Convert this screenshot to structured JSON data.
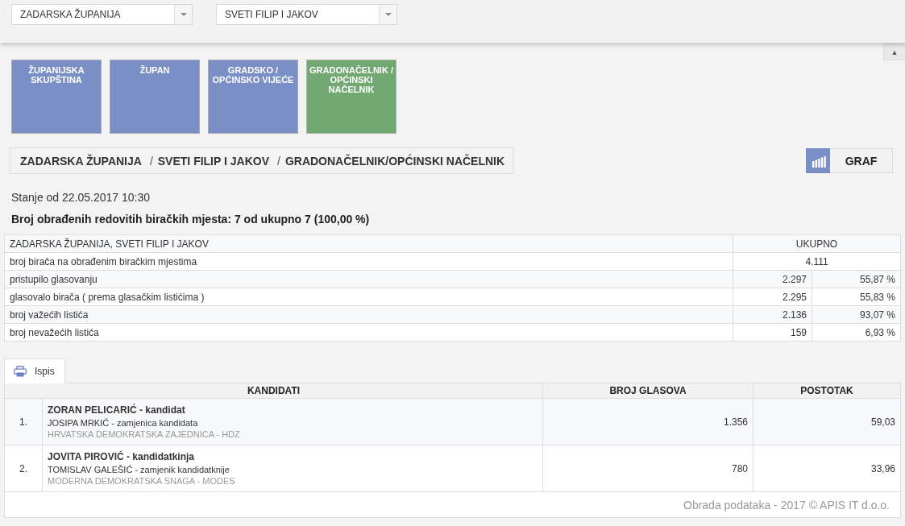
{
  "filters": [
    {
      "value": "ZADARSKA ŽUPANIJA"
    },
    {
      "value": "SVETI FILIP I JAKOV"
    }
  ],
  "collapse_button": {
    "label": "▲"
  },
  "election_tiles": [
    {
      "label": "ŽUPANIJSKA SKUPŠTINA",
      "selected": false
    },
    {
      "label": "ŽUPAN",
      "selected": false
    },
    {
      "label": "GRADSKO / OPĆINSKO VIJEĆE",
      "selected": false
    },
    {
      "label": "GRADONAČELNIK / OPĆINSKI NAČELNIK",
      "selected": true
    }
  ],
  "breadcrumb": [
    {
      "label": "ZADARSKA ŽUPANIJA"
    },
    {
      "separator": "/",
      "label": "SVETI FILIP I JAKOV"
    },
    {
      "separator": "/",
      "label": "GRADONAČELNIK/OPĆINSKI NAČELNIK"
    }
  ],
  "graf_button": {
    "label": "GRAF"
  },
  "status_time": "Stanje od 22.05.2017 10:30",
  "processed_summary": "Broj obrađenih redovitih biračkih mjesta: 7 od ukupno 7 (100,00 %)",
  "summary_table": {
    "columns": [
      "ZADARSKA ŽUPANIJA, SVETI FILIP I JAKOV",
      "UKUPNO"
    ],
    "rows": [
      {
        "label": "broj birača na obrađenim biračkim mjestima",
        "value": "4.111"
      },
      {
        "label": "pristupilo glasovanju",
        "value": "2.297",
        "percent": "55,87 %"
      },
      {
        "label": "glasovalo birača ( prema glasačkim listićima )",
        "value": "2.295",
        "percent": "55,83 %"
      },
      {
        "label": "broj važećih listića",
        "value": "2.136",
        "percent": "93,07 %"
      },
      {
        "label": "broj nevažećih listića",
        "value": "159",
        "percent": "6,93 %"
      }
    ]
  },
  "print_tab": {
    "label": "Ispis"
  },
  "candidates_table": {
    "columns": [
      "KANDIDATI",
      "BROJ GLASOVA",
      "POSTOTAK"
    ],
    "rows": [
      {
        "rank": "1.",
        "name": "ZORAN PELICARIĆ - kandidat",
        "deputy": "JOSIPA MRKIĆ - zamjenica kandidata",
        "party": "HRVATSKA DEMOKRATSKA ZAJEDNICA - HDZ",
        "votes": "1.356",
        "percent": "59,03"
      },
      {
        "rank": "2.",
        "name": "JOVITA PIROVIĆ - kandidatkinja",
        "deputy": "TOMISLAV GALEŠIĆ - zamjenik kandidatknije",
        "party": "MODERNA DEMOKRATSKA SNAGA - MODES",
        "votes": "780",
        "percent": "33,96"
      }
    ],
    "footer": "Obrada podataka - 2017 © APIS IT d.o.o."
  }
}
